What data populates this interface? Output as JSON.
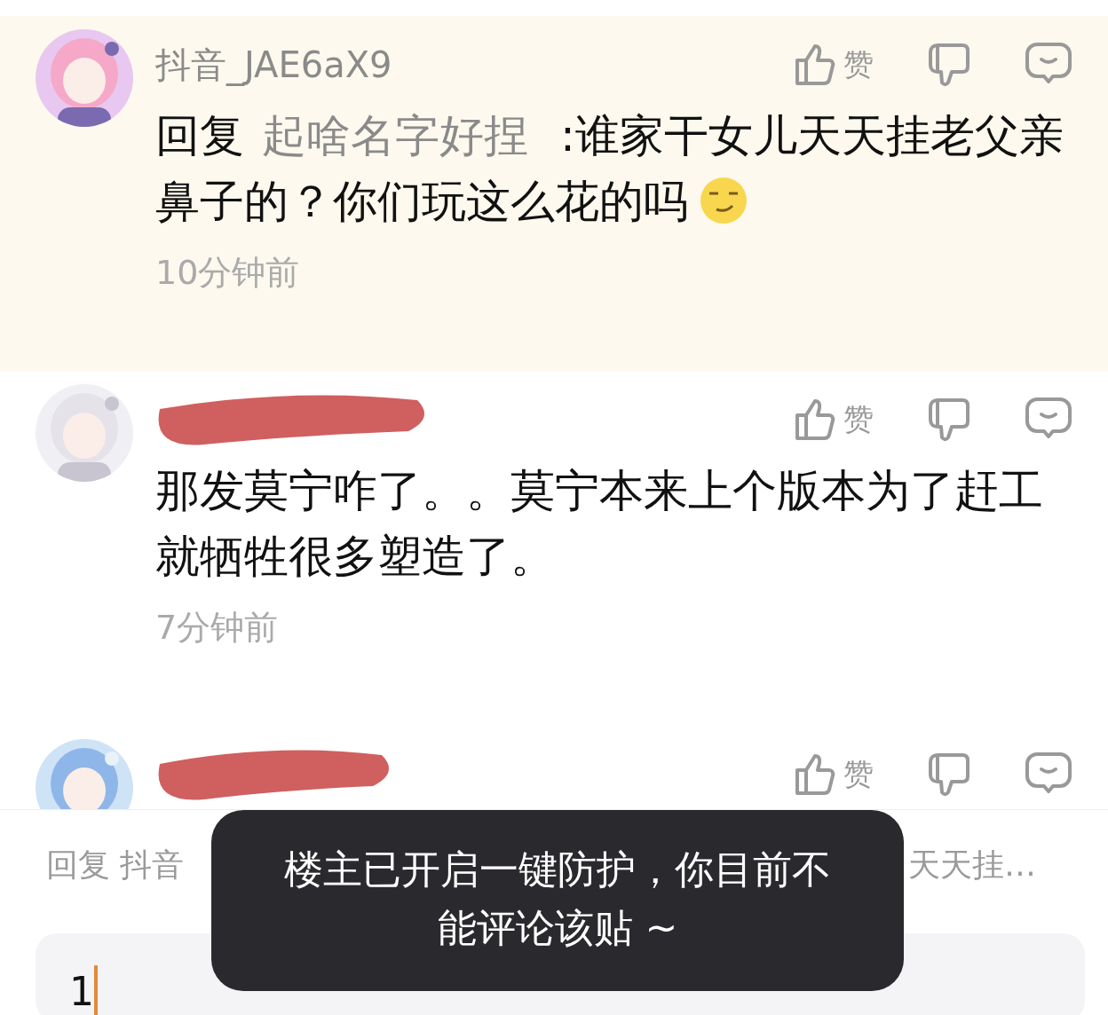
{
  "comments": [
    {
      "name": "抖音_JAE6aX9",
      "name_hidden": false,
      "highlighted": true,
      "reply_prefix": "回复",
      "mention": "起啥名字好捏",
      "text": " :谁家干女儿天天挂老父亲鼻子的？你们玩这么花的吗",
      "emoji": true,
      "like_label": "赞",
      "time": "10分钟前"
    },
    {
      "name_hidden": true,
      "highlighted": false,
      "text": "那发莫宁咋了。。莫宁本来上个版本为了赶工就牺牲很多塑造了。",
      "like_label": "赞",
      "time": "7分钟前"
    },
    {
      "name_hidden": true,
      "highlighted": false,
      "like_label": "赞"
    }
  ],
  "reply_bar": {
    "hint_start": "回复 抖音",
    "hint_end": "天天挂…",
    "value": "1"
  },
  "toast": {
    "text": "楼主已开启一键防护，你目前不能评论该贴 ~"
  }
}
